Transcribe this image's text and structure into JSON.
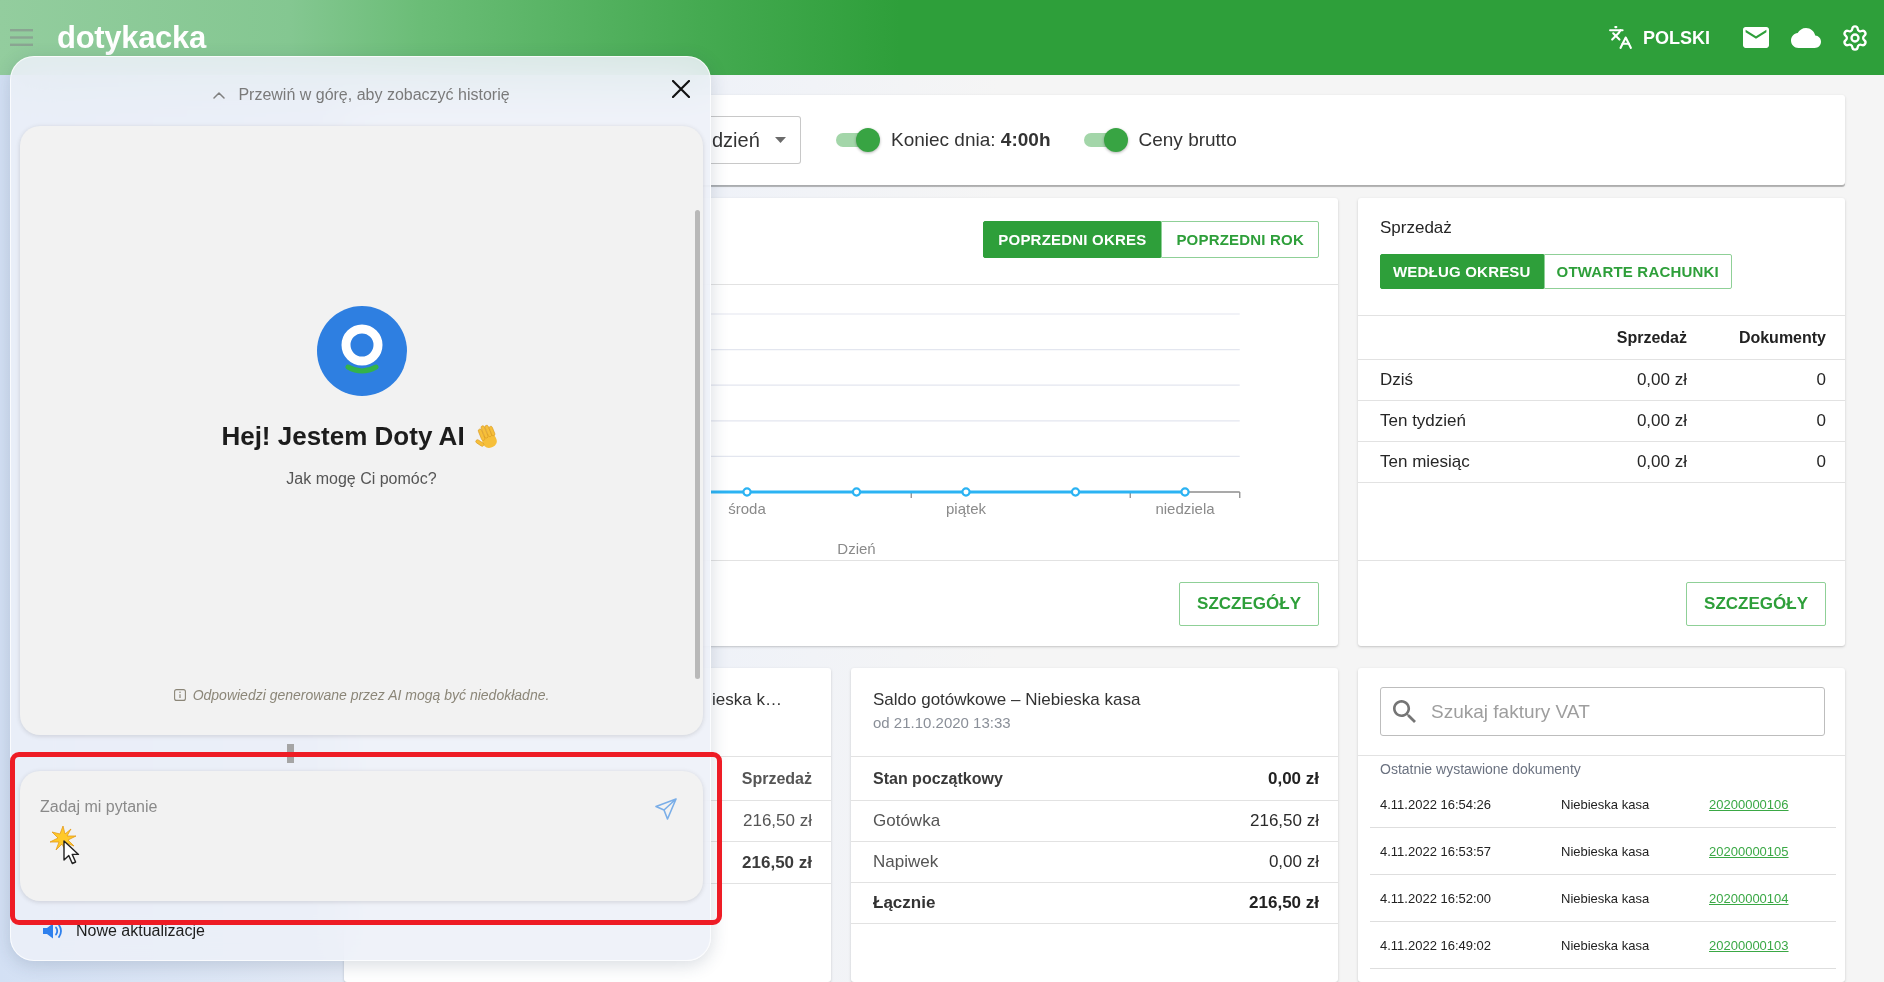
{
  "header": {
    "logo": "dotykacka",
    "language": "POLSKI"
  },
  "toolbar": {
    "period_select": {
      "value": "dzień"
    },
    "toggles": [
      {
        "label": "Koniec dnia: **4:00h**",
        "on": true
      },
      {
        "label": "Ceny brutto",
        "on": true
      }
    ]
  },
  "chart_card": {
    "compare_buttons": [
      {
        "label": "POPRZEDNI OKRES",
        "selected": true
      },
      {
        "label": "POPRZEDNI ROK",
        "selected": false
      }
    ],
    "chart": {
      "x_labels": [
        "środa",
        "piątek",
        "niedziela"
      ],
      "xlabel": "Dzień"
    },
    "details_button": "SZCZEGÓŁY"
  },
  "sales_card": {
    "title": "Sprzedaż",
    "tabs": [
      {
        "label": "WEDŁUG OKRESU",
        "selected": true
      },
      {
        "label": "OTWARTE RACHUNKI",
        "selected": false
      }
    ],
    "columns": [
      "Sprzedaż",
      "Dokumenty"
    ],
    "rows": [
      {
        "period": "Dziś",
        "sales": "0,00 zł",
        "documents": "0"
      },
      {
        "period": "Ten tydzień",
        "sales": "0,00 zł",
        "documents": "0"
      },
      {
        "period": "Ten miesiąc",
        "sales": "0,00 zł",
        "documents": "0"
      }
    ],
    "details_button": "SZCZEGÓŁY"
  },
  "register_card": {
    "title": "ieska k…",
    "column": "Sprzedaż",
    "rows": [
      {
        "value": "216,50 zł",
        "kind": "item"
      },
      {
        "value": "216,50 zł",
        "kind": "total"
      }
    ]
  },
  "cash_card": {
    "title": "Saldo gotówkowe – Niebieska kasa",
    "subtitle": "od 21.10.2020 13:33",
    "rows": [
      {
        "label": "Stan początkowy",
        "value": "0,00 zł",
        "kind": "opening"
      },
      {
        "label": "Gotówka",
        "value": "216,50 zł",
        "kind": "item"
      },
      {
        "label": "Napiwek",
        "value": "0,00 zł",
        "kind": "item"
      },
      {
        "label": "Łącznie",
        "value": "216,50 zł",
        "kind": "total"
      }
    ]
  },
  "invoice_card": {
    "search": {
      "placeholder": "Szukaj faktury VAT"
    },
    "section_title": "Ostatnie wystawione dokumenty",
    "documents": [
      {
        "time": "4.11.2022 16:54:26",
        "register": "Niebieska kasa",
        "number": "20200000106"
      },
      {
        "time": "4.11.2022 16:53:57",
        "register": "Niebieska kasa",
        "number": "20200000105"
      },
      {
        "time": "4.11.2022 16:52:00",
        "register": "Niebieska kasa",
        "number": "20200000104"
      },
      {
        "time": "4.11.2022 16:49:02",
        "register": "Niebieska kasa",
        "number": "20200000103"
      }
    ]
  },
  "assistant_panel": {
    "scroll_hint": "Przewiń w górę, aby zobaczyć historię",
    "greeting": "Hej! Jestem Doty AI",
    "subtitle": "Jak mogę Ci pomóc?",
    "disclaimer": "Odpowiedzi generowane przez AI mogą być niedokładne.",
    "input": {
      "placeholder": "Zadaj mi pytanie"
    },
    "updates_link": "Nowe aktualizacje"
  }
}
